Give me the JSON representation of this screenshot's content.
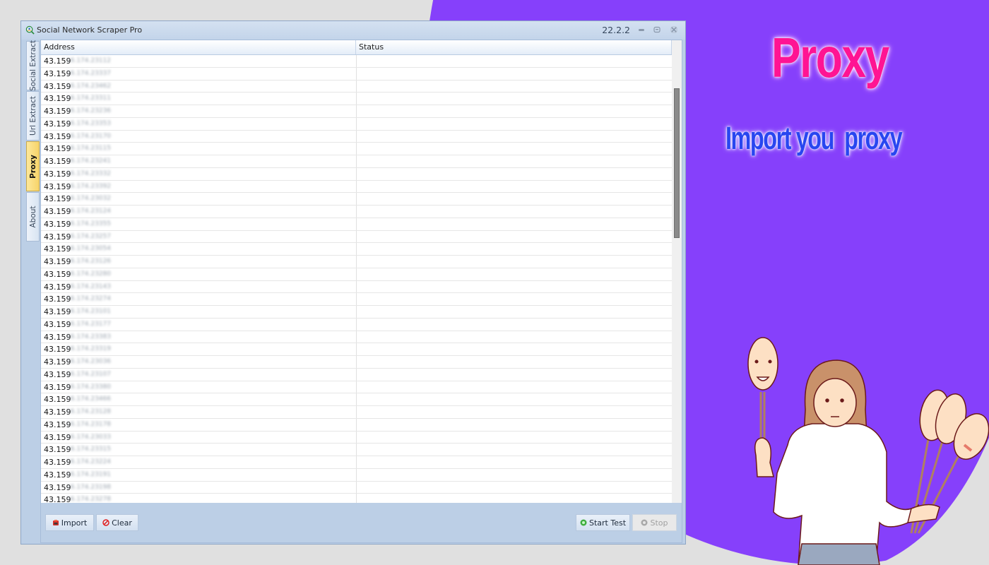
{
  "window": {
    "title": "Social Network Scraper Pro",
    "version": "22.2.2",
    "controls": {
      "minimize": "–",
      "maximize": "▫",
      "close": "×"
    }
  },
  "side_tabs": [
    {
      "label": "Social Extract",
      "active": false
    },
    {
      "label": "Url Extract",
      "active": false
    },
    {
      "label": "Proxy",
      "active": true
    },
    {
      "label": "About",
      "active": false
    }
  ],
  "grid": {
    "columns": [
      "Address",
      "Status"
    ],
    "rows": [
      {
        "address_visible": "43.159",
        "address_hidden": "16.174.23112",
        "status": ""
      },
      {
        "address_visible": "43.159",
        "address_hidden": "16.174.23337",
        "status": ""
      },
      {
        "address_visible": "43.159",
        "address_hidden": "16.174.23462",
        "status": ""
      },
      {
        "address_visible": "43.159",
        "address_hidden": "16.174.23311",
        "status": ""
      },
      {
        "address_visible": "43.159",
        "address_hidden": "16.174.23236",
        "status": ""
      },
      {
        "address_visible": "43.159",
        "address_hidden": "16.174.23353",
        "status": ""
      },
      {
        "address_visible": "43.159",
        "address_hidden": "16.174.23170",
        "status": ""
      },
      {
        "address_visible": "43.159",
        "address_hidden": "16.174.23115",
        "status": ""
      },
      {
        "address_visible": "43.159",
        "address_hidden": "16.174.23241",
        "status": ""
      },
      {
        "address_visible": "43.159",
        "address_hidden": "16.174.23332",
        "status": ""
      },
      {
        "address_visible": "43.159",
        "address_hidden": "16.174.23392",
        "status": ""
      },
      {
        "address_visible": "43.159",
        "address_hidden": "16.174.23032",
        "status": ""
      },
      {
        "address_visible": "43.159",
        "address_hidden": "16.174.23124",
        "status": ""
      },
      {
        "address_visible": "43.159",
        "address_hidden": "16.174.23355",
        "status": ""
      },
      {
        "address_visible": "43.159",
        "address_hidden": "16.174.23257",
        "status": ""
      },
      {
        "address_visible": "43.159",
        "address_hidden": "16.174.23054",
        "status": ""
      },
      {
        "address_visible": "43.159",
        "address_hidden": "16.174.23126",
        "status": ""
      },
      {
        "address_visible": "43.159",
        "address_hidden": "16.174.23280",
        "status": ""
      },
      {
        "address_visible": "43.159",
        "address_hidden": "16.174.23143",
        "status": ""
      },
      {
        "address_visible": "43.159",
        "address_hidden": "16.174.23274",
        "status": ""
      },
      {
        "address_visible": "43.159",
        "address_hidden": "16.174.23101",
        "status": ""
      },
      {
        "address_visible": "43.159",
        "address_hidden": "16.174.23177",
        "status": ""
      },
      {
        "address_visible": "43.159",
        "address_hidden": "16.174.23383",
        "status": ""
      },
      {
        "address_visible": "43.159",
        "address_hidden": "16.174.23319",
        "status": ""
      },
      {
        "address_visible": "43.159",
        "address_hidden": "16.174.23036",
        "status": ""
      },
      {
        "address_visible": "43.159",
        "address_hidden": "16.174.23107",
        "status": ""
      },
      {
        "address_visible": "43.159",
        "address_hidden": "16.174.23380",
        "status": ""
      },
      {
        "address_visible": "43.159",
        "address_hidden": "16.174.23466",
        "status": ""
      },
      {
        "address_visible": "43.159",
        "address_hidden": "16.174.23128",
        "status": ""
      },
      {
        "address_visible": "43.159",
        "address_hidden": "16.174.23178",
        "status": ""
      },
      {
        "address_visible": "43.159",
        "address_hidden": "16.174.23033",
        "status": ""
      },
      {
        "address_visible": "43.159",
        "address_hidden": "16.174.23315",
        "status": ""
      },
      {
        "address_visible": "43.159",
        "address_hidden": "16.174.23224",
        "status": ""
      },
      {
        "address_visible": "43.159",
        "address_hidden": "16.174.23191",
        "status": ""
      },
      {
        "address_visible": "43.159",
        "address_hidden": "16.174.23198",
        "status": ""
      },
      {
        "address_visible": "43.159",
        "address_hidden": "16.174.23278",
        "status": ""
      }
    ]
  },
  "buttons": {
    "import": {
      "label": "Import",
      "icon": "import-icon"
    },
    "clear": {
      "label": "Clear",
      "icon": "ban-icon"
    },
    "start_test": {
      "label": "Start Test",
      "icon": "play-circle-icon"
    },
    "stop": {
      "label": "Stop",
      "icon": "stop-circle-icon",
      "disabled": true
    }
  },
  "promo": {
    "headline": "Proxy",
    "subline": "Import you  proxy"
  },
  "colors": {
    "background_purple": "#8640fb",
    "headline_pink": "#ff1493",
    "subline_blue": "#2846f0",
    "active_tab": "#f7d46a"
  }
}
